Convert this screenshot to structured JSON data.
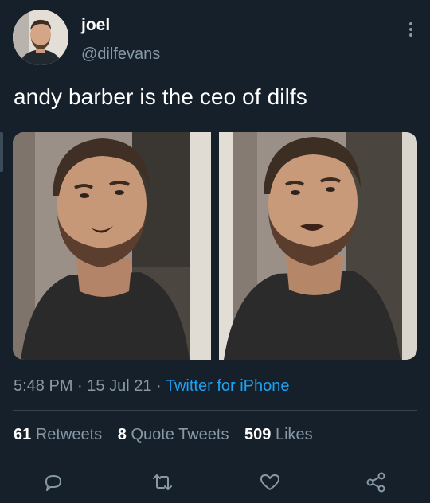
{
  "tweet": {
    "author": {
      "name": "joel",
      "handle": "@dilfevans"
    },
    "text": "andy barber is the ceo of dilfs",
    "time": "5:48 PM",
    "separator": " · ",
    "date": "15 Jul 21",
    "source": "Twitter for iPhone",
    "media_count": 2
  },
  "stats": {
    "retweets": {
      "count": "61",
      "label": "Retweets"
    },
    "quote_tweets": {
      "count": "8",
      "label": "Quote Tweets"
    },
    "likes": {
      "count": "509",
      "label": "Likes"
    }
  },
  "actions": [
    "reply-icon",
    "retweet-icon",
    "like-icon",
    "share-icon"
  ],
  "colors": {
    "background": "#15202b",
    "text_primary": "#ffffff",
    "text_secondary": "#8899a6",
    "accent": "#1da1f2",
    "divider": "#38444d"
  }
}
